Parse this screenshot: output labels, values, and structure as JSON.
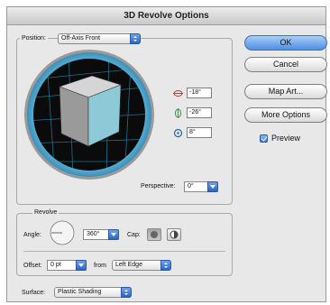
{
  "dialog": {
    "title": "3D Revolve Options"
  },
  "position": {
    "label": "Position:",
    "selected": "Off-Axis Front",
    "rotation_x": "-18°",
    "rotation_y": "-26°",
    "rotation_z": "8°",
    "perspective_label": "Perspective:",
    "perspective_value": "0°"
  },
  "revolve": {
    "group_label": "Revolve",
    "angle_label": "Angle:",
    "angle_value": "360°",
    "cap_label": "Cap:",
    "offset_label": "Offset:",
    "offset_value": "0 pt",
    "from_label": "from",
    "from_selected": "Left Edge"
  },
  "surface": {
    "label": "Surface:",
    "selected": "Plastic Shading"
  },
  "buttons": {
    "ok": "OK",
    "cancel": "Cancel",
    "map_art": "Map Art...",
    "more_options": "More Options"
  },
  "preview": {
    "label": "Preview",
    "checked": true
  },
  "icons": [
    "x-rotation-icon",
    "y-rotation-icon",
    "z-rotation-icon",
    "cap-on-icon",
    "cap-off-icon"
  ]
}
